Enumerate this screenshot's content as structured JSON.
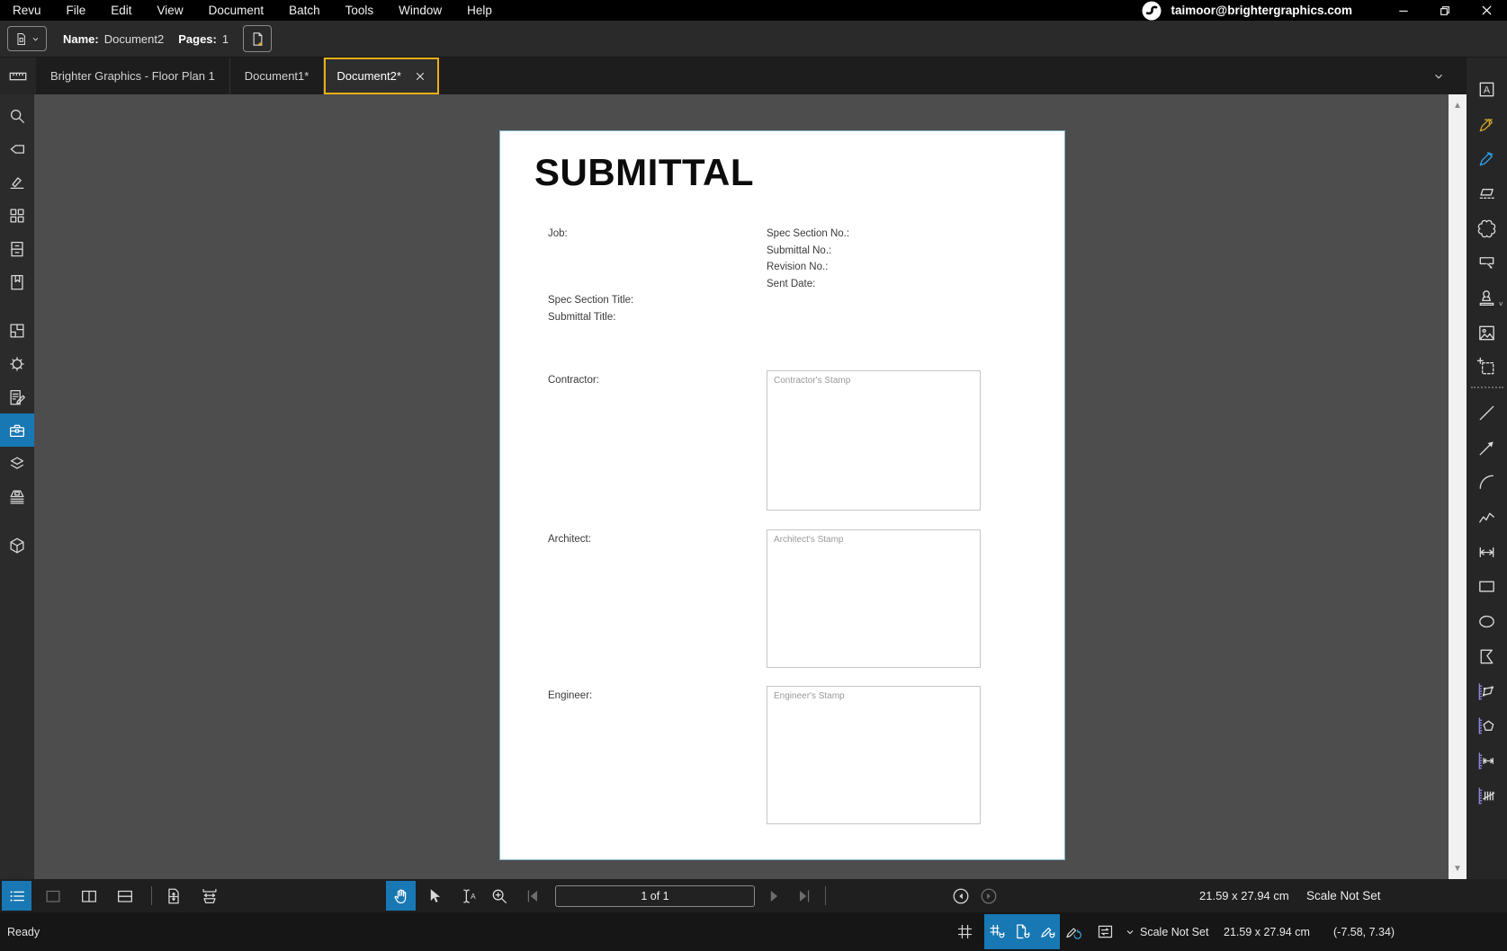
{
  "colors": {
    "accent_blue": "#1878b4",
    "tab_active_yellow": "#ecb016",
    "pen_yellow": "#c8a02b",
    "pen_blue": "#2e9fe6",
    "measure_purple": "#8d86e0",
    "refresh_blue": "#3f9fd8"
  },
  "menu_bar": {
    "items": [
      "Revu",
      "File",
      "Edit",
      "View",
      "Document",
      "Batch",
      "Tools",
      "Window",
      "Help"
    ],
    "user_email": "taimoor@brightergraphics.com"
  },
  "doc_bar": {
    "name_label": "Name:",
    "name_value": "Document2",
    "pages_label": "Pages:",
    "pages_value": "1"
  },
  "tab_bar": {
    "tabs": [
      {
        "label": "Brighter Graphics - Floor Plan 1",
        "active": false,
        "closable": false
      },
      {
        "label": "Document1*",
        "active": false,
        "closable": false
      },
      {
        "label": "Document2*",
        "active": true,
        "closable": true
      }
    ]
  },
  "left_sidebar": {
    "items": [
      {
        "icon": "search"
      },
      {
        "icon": "tag"
      },
      {
        "icon": "signature"
      },
      {
        "icon": "thumbnails"
      },
      {
        "icon": "file-access"
      },
      {
        "icon": "bookmarks"
      },
      {
        "gap": true
      },
      {
        "icon": "spaces"
      },
      {
        "icon": "settings"
      },
      {
        "icon": "markup-summary"
      },
      {
        "icon": "tool-chest",
        "active": true
      },
      {
        "icon": "layers"
      },
      {
        "icon": "3d-model"
      },
      {
        "gap": true
      },
      {
        "icon": "studio"
      }
    ]
  },
  "right_toolbar": {
    "items": [
      {
        "icon": "note-text"
      },
      {
        "icon": "pen-yellow"
      },
      {
        "icon": "pen-blue"
      },
      {
        "icon": "highlighter"
      },
      {
        "icon": "cloud"
      },
      {
        "icon": "callout"
      },
      {
        "icon": "stamp",
        "chevron": true
      },
      {
        "icon": "image"
      },
      {
        "icon": "snapshot"
      },
      {
        "sep": true
      },
      {
        "icon": "line"
      },
      {
        "icon": "arrow"
      },
      {
        "icon": "arc"
      },
      {
        "icon": "polyline"
      },
      {
        "icon": "dimension"
      },
      {
        "icon": "rectangle"
      },
      {
        "icon": "ellipse"
      },
      {
        "icon": "polygon"
      },
      {
        "icon": "measure-perimeter"
      },
      {
        "icon": "measure-area"
      },
      {
        "icon": "measure-length"
      },
      {
        "icon": "measure-count"
      }
    ]
  },
  "document": {
    "title": "SUBMITTAL",
    "job_label": "Job:",
    "right_fields": [
      "Spec Section No.:",
      "Submittal No.:",
      "Revision No.:",
      "Sent Date:"
    ],
    "left_fields": [
      "Spec Section Title:",
      "Submittal Title:"
    ],
    "sections": [
      {
        "label": "Contractor:",
        "stamp_placeholder": "Contractor's Stamp"
      },
      {
        "label": "Architect:",
        "stamp_placeholder": "Architect's Stamp"
      },
      {
        "label": "Engineer:",
        "stamp_placeholder": "Engineer's Stamp"
      }
    ]
  },
  "bottom_toolbar": {
    "left_tools": [
      {
        "icon": "markup-list",
        "active": true
      },
      {
        "icon": "single-pane",
        "dim": true
      },
      {
        "icon": "split-vertical"
      },
      {
        "icon": "split-horizontal"
      },
      {
        "sep": true
      },
      {
        "icon": "fit-page"
      },
      {
        "icon": "fit-width"
      }
    ],
    "center_tools": [
      {
        "icon": "pan",
        "active": true
      },
      {
        "icon": "select"
      },
      {
        "icon": "select-text"
      },
      {
        "icon": "zoom"
      },
      {
        "icon": "first-page",
        "dim": true
      },
      {
        "icon": "prev-page",
        "dim": true
      }
    ],
    "page_indicator": "1 of 1",
    "after_tools": [
      {
        "icon": "next-page",
        "dim": true
      },
      {
        "icon": "last-page",
        "dim": true
      },
      {
        "sep": true
      }
    ],
    "view_tools": [
      {
        "icon": "previous-view"
      },
      {
        "icon": "next-view",
        "dim": true
      }
    ],
    "page_size": "21.59 x 27.94 cm",
    "scale": "Scale Not Set"
  },
  "status_bar": {
    "status": "Ready",
    "tools": [
      {
        "icon": "grid"
      },
      {
        "icon": "snap-grid",
        "active": true
      },
      {
        "icon": "snap-document",
        "active": true
      },
      {
        "icon": "snap-markup",
        "active": true
      },
      {
        "icon": "markup-reuse"
      },
      {
        "icon": "sync-views"
      }
    ],
    "scale_dropdown": "Scale Not Set",
    "page_size": "21.59 x 27.94 cm",
    "coordinates": "(-7.58, 7.34)"
  }
}
